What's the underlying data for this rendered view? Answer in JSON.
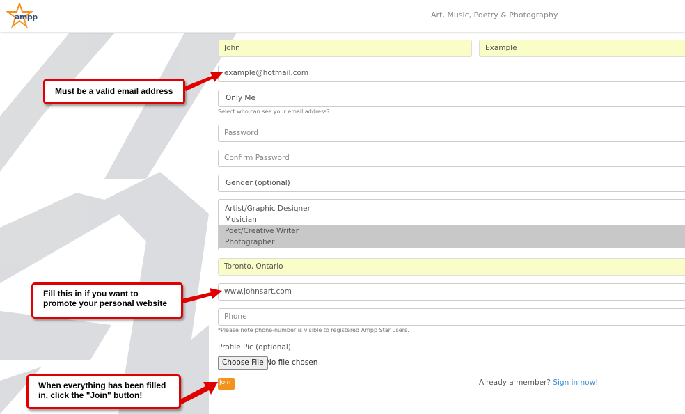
{
  "header": {
    "logo_text": "ampp",
    "tagline": "Art, Music, Poetry & Photography"
  },
  "form": {
    "first_name_value": "John",
    "last_name_value": "Example",
    "email_value": "example@hotmail.com",
    "email_visibility_value": "Only Me",
    "email_visibility_hint": "Select who can see your email address?",
    "password_placeholder": "Password",
    "confirm_password_placeholder": "Confirm Password",
    "gender_value": "Gender (optional)",
    "categories": [
      {
        "label": "Artist/Graphic Designer",
        "selected": false
      },
      {
        "label": "Musician",
        "selected": false
      },
      {
        "label": "Poet/Creative Writer",
        "selected": true
      },
      {
        "label": "Photographer",
        "selected": true
      }
    ],
    "location_value": "Toronto, Ontario",
    "website_value": "www.johnsart.com",
    "phone_placeholder": "Phone",
    "phone_hint": "*Please note phone-number is visible to registered Ampp Star users.",
    "profile_pic_label": "Profile Pic (optional)",
    "choose_file_label": "Choose File",
    "no_file_text": "No file chosen",
    "join_label": "Join",
    "already_member_text": "Already a member?",
    "sign_in_link": "Sign in now!"
  },
  "annotations": {
    "email_note": "Must be a valid email address",
    "website_note_line1": "Fill this in if you want to",
    "website_note_line2": "promote your personal website",
    "join_note_line1": "When everything has been filled",
    "join_note_line2": "in, click the \"Join\" button!"
  },
  "colors": {
    "accent": "#f2931e",
    "link": "#3b8fd9",
    "autofill": "#fafdc8",
    "callout_border": "#e00000"
  }
}
